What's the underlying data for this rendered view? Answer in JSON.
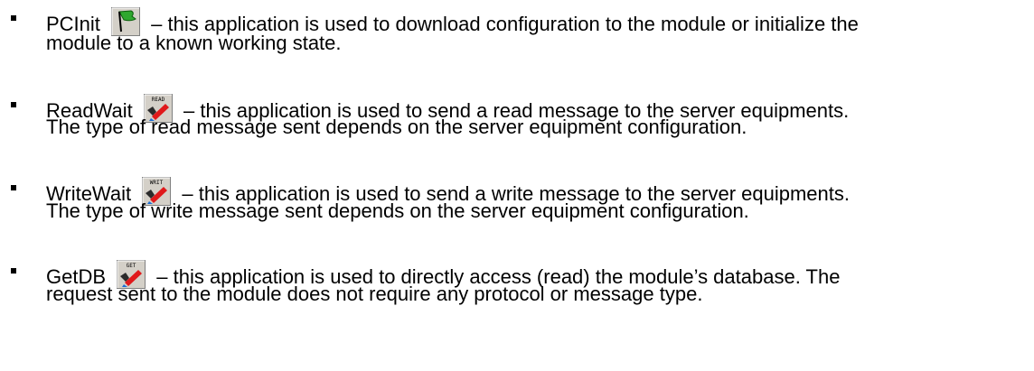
{
  "items": [
    {
      "app_name": "PCInit",
      "icon": "green-flag-icon",
      "line1": "– this application is used to download configuration to the module or initialize the",
      "line2": "module to a known working state."
    },
    {
      "app_name": "ReadWait",
      "icon": "read-icon",
      "icon_label": "READ",
      "line1": "– this application is used to send a read message to the server equipments.",
      "line2": "The type of read message sent depends on the server equipment configuration."
    },
    {
      "app_name": "WriteWait",
      "icon": "write-icon",
      "icon_label": "WRIT",
      "line1": "– this application is used to send a write message to the server equipments.",
      "line2": "The type of write message sent depends on the server equipment configuration."
    },
    {
      "app_name": "GetDB",
      "icon": "get-icon",
      "icon_label": "GET",
      "line1": "– this application is used to directly access (read) the module’s database. The",
      "line2": "request sent to the module does not require any protocol or message type."
    }
  ]
}
